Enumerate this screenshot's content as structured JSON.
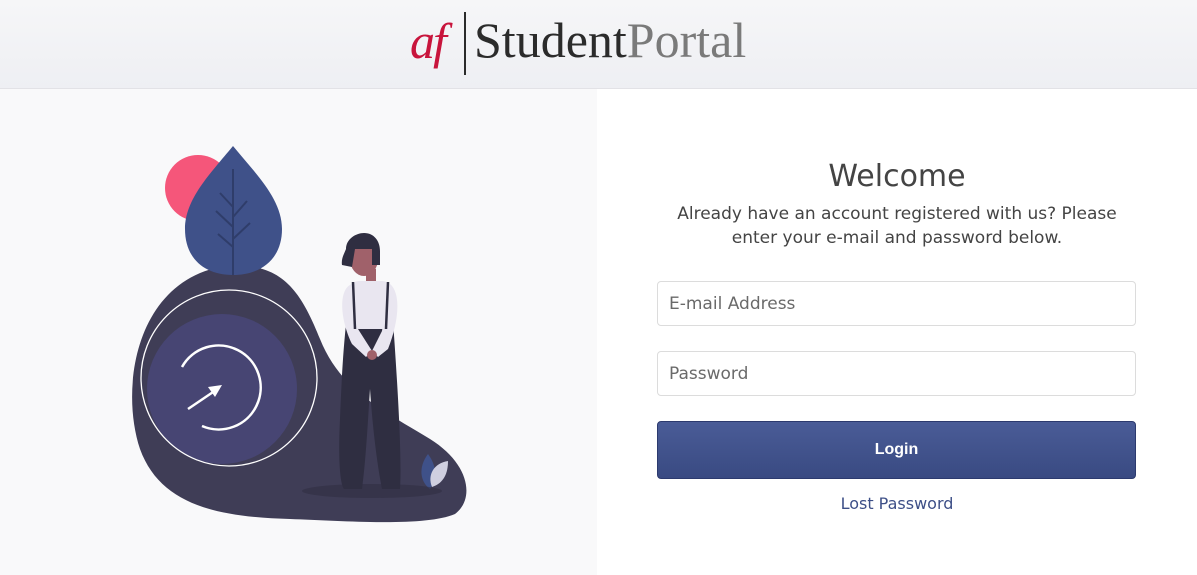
{
  "header": {
    "logo_mark": "af",
    "logo_word_1": "Student",
    "logo_word_2": "Portal"
  },
  "illustration": {
    "icons": [
      "history-arrow-icon",
      "leaf-icon",
      "person-illustration"
    ]
  },
  "login": {
    "title": "Welcome",
    "subtitle": "Already have an account registered with us? Please enter your e-mail and password below.",
    "email_placeholder": "E-mail Address",
    "email_value": "",
    "password_placeholder": "Password",
    "password_value": "",
    "login_label": "Login",
    "lost_password_label": "Lost Password"
  },
  "colors": {
    "brand_red": "#c8143c",
    "button_blue": "#3f5189",
    "link_blue": "#3d4f87",
    "blob_dark": "#3f3d56",
    "leaf_blue": "#3f5189",
    "sun_pink": "#f5567a"
  }
}
